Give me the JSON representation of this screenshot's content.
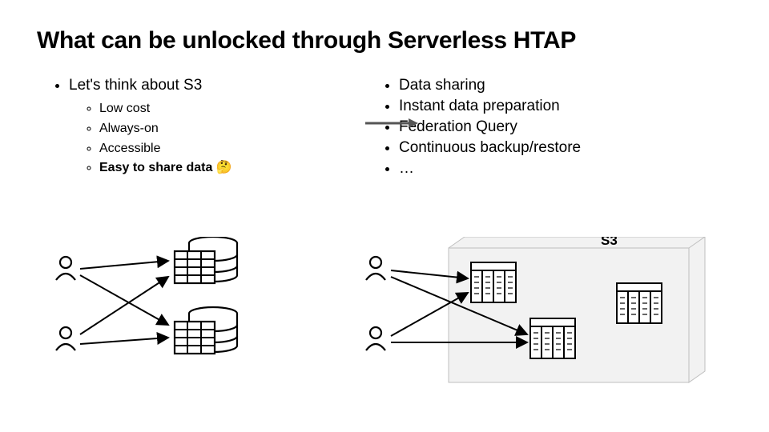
{
  "title": "What can be unlocked through Serverless HTAP",
  "left": {
    "heading": "Let's think about S3",
    "items": [
      "Low cost",
      "Always-on",
      "Accessible"
    ],
    "bold_item": "Easy to share data 🤔"
  },
  "right": {
    "items": [
      "Data sharing",
      "Instant data preparation",
      "Federation Query",
      "Continuous backup/restore",
      "…"
    ]
  },
  "s3_label": "S3"
}
